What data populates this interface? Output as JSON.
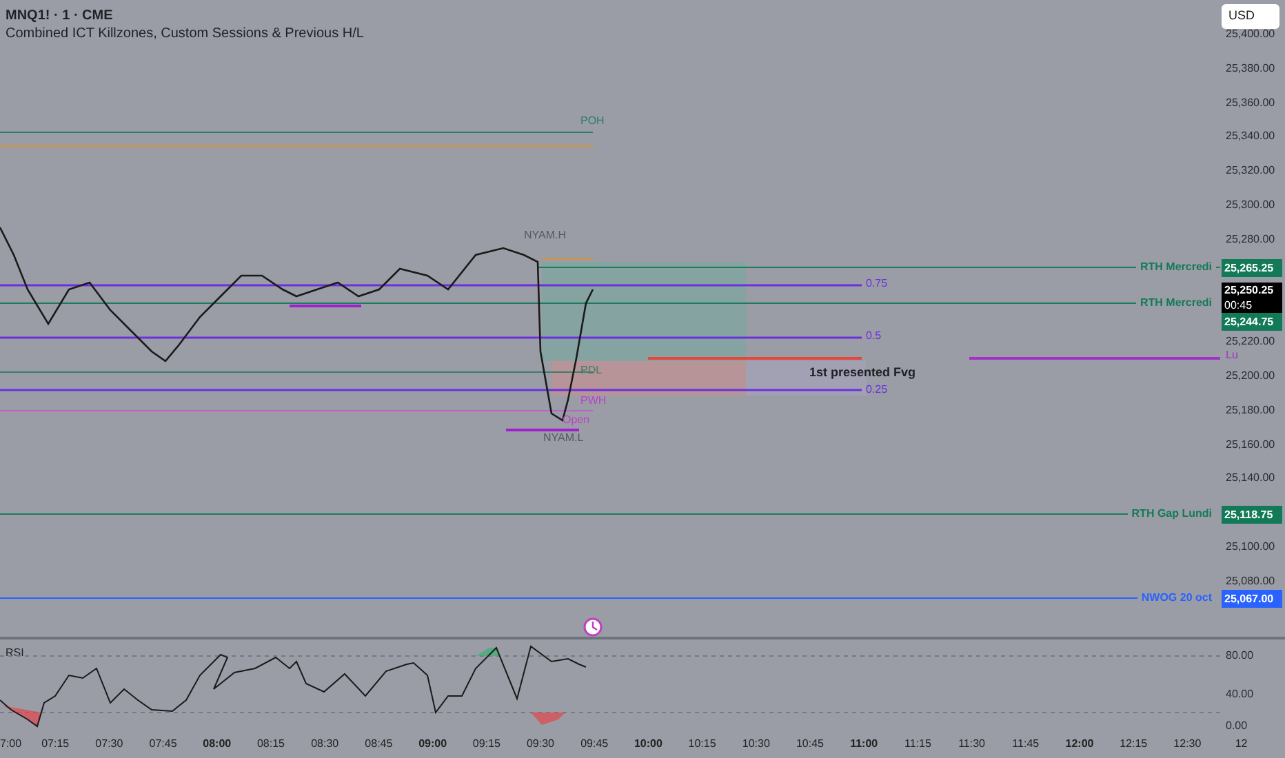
{
  "header": {
    "title": "MNQ1! · 1 · CME",
    "indicator": "Combined ICT Killzones, Custom Sessions & Previous H/L"
  },
  "currency": "USD",
  "price_ticks": [
    "25,400.00",
    "25,380.00",
    "25,360.00",
    "25,340.00",
    "25,320.00",
    "25,300.00",
    "25,280.00",
    "25,220.00",
    "25,200.00",
    "25,180.00",
    "25,160.00",
    "25,140.00",
    "25,100.00",
    "25,080.00"
  ],
  "chart_labels": [
    "POH",
    "NYAM.H",
    "0.75",
    "0.5",
    "PDL",
    "1st presented Fvg",
    "0.25",
    "PWH",
    "Open",
    "NYAM.L",
    "Lu"
  ],
  "price_tags": [
    {
      "label": "RTH Mercredi",
      "price": "25,265.25",
      "color": "#137a57"
    },
    {
      "label": "RTH Mercredi",
      "price": "25,244.75",
      "color": "#137a57"
    },
    {
      "label": "RTH Gap Lundi",
      "price": "25,118.75",
      "color": "#137a57"
    },
    {
      "label": "NWOG 20 oct",
      "price": "25,067.00",
      "color": "#2962ff"
    }
  ],
  "last_price": {
    "price": "25,250.25",
    "countdown": "00:45"
  },
  "rsi": {
    "title": "RSI",
    "ticks": [
      "80.00",
      "40.00",
      "0.00"
    ]
  },
  "time_ticks": [
    "7:00",
    "07:15",
    "07:30",
    "07:45",
    "08:00",
    "08:15",
    "08:30",
    "08:45",
    "09:00",
    "09:15",
    "09:30",
    "09:45",
    "10:00",
    "10:15",
    "10:30",
    "10:45",
    "11:00",
    "11:15",
    "11:30",
    "11:45",
    "12:00",
    "12:15",
    "12:30",
    "12"
  ]
}
